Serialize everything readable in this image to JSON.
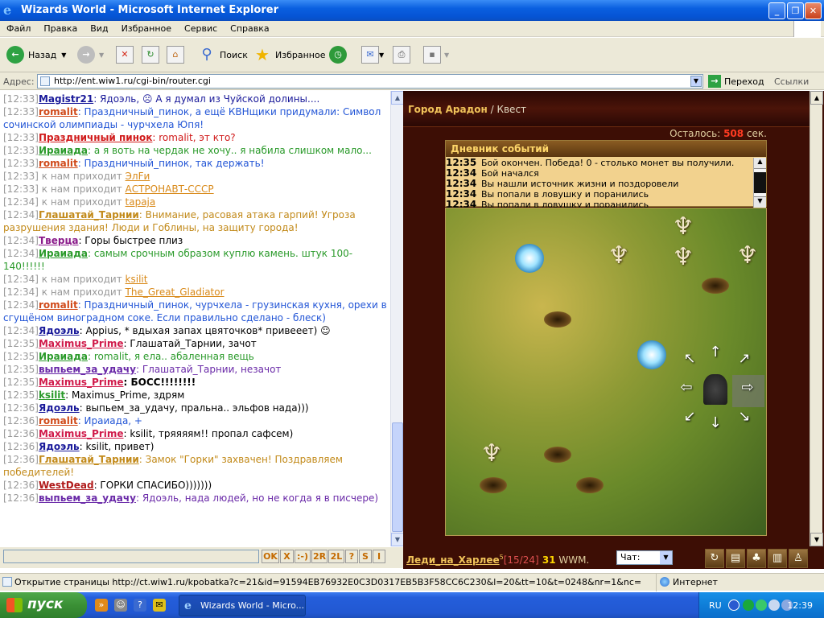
{
  "window": {
    "title": "Wizards World - Microsoft Internet Explorer"
  },
  "menu": [
    "Файл",
    "Правка",
    "Вид",
    "Избранное",
    "Сервис",
    "Справка"
  ],
  "toolbar": {
    "back": "Назад",
    "search": "Поиск",
    "favorites": "Избранное"
  },
  "address": {
    "label": "Адрес:",
    "url": "http://ent.wiw1.ru/cgi-bin/router.cgi",
    "go": "Переход",
    "links": "Ссылки"
  },
  "chat": [
    {
      "time": "[12:33]",
      "user": "Magistr21",
      "ucolor": "#1a1a9a",
      "text": ": Ядоэль, ☹ А я думал из Чуйской долины....",
      "tcolor": "#1a1a9a"
    },
    {
      "time": "[12:33]",
      "user": "romalit",
      "ucolor": "#d04a1a",
      "text": ": Праздничный_пинок, а ещё КВНщики придумали: Символ сочинской олимпиады - чурчхела Юпя!",
      "tcolor": "#2255d6"
    },
    {
      "time": "[12:33]",
      "user": "Праздничный пинок",
      "ucolor": "#d01a1a",
      "text": ": romalit, эт кто?",
      "tcolor": "#d01a1a"
    },
    {
      "time": "[12:33]",
      "user": "Ираиада",
      "ucolor": "#2a9a2a",
      "text": ": а я воть на чердак не хочу.. я набила слишком мало...",
      "tcolor": "#2a9a2a"
    },
    {
      "time": "[12:33]",
      "user": "romalit",
      "ucolor": "#d04a1a",
      "text": ": Праздничный_пинок, так держать!",
      "tcolor": "#2255d6"
    },
    {
      "time": "[12:33]",
      "sys": "к нам приходит",
      "name": "ЭлFи"
    },
    {
      "time": "[12:33]",
      "sys": "к нам приходит",
      "name": "АСТРОНАВТ-СССР"
    },
    {
      "time": "[12:34]",
      "sys": "к нам приходит",
      "name": "tapaja"
    },
    {
      "time": "[12:34]",
      "user": "Глашатай_Тарнии",
      "ucolor": "#c28a1a",
      "text": ": Внимание, расовая атака гарпий! Угроза разрушения здания! Люди и Гоблины, на защиту города!",
      "tcolor": "#c28a1a"
    },
    {
      "time": "[12:34]",
      "user": "Тверца",
      "ucolor": "#8a1a8a",
      "text": ": Горы быстрее плиз",
      "tcolor": "#000"
    },
    {
      "time": "[12:34]",
      "user": "Ираиада",
      "ucolor": "#2a9a2a",
      "text": ": самым срочным образом куплю камень. штук 100-140!!!!!!",
      "tcolor": "#2a9a2a"
    },
    {
      "time": "[12:34]",
      "sys": "к нам приходит",
      "name": "ksilit"
    },
    {
      "time": "[12:34]",
      "sys": "к нам приходит",
      "name": "The_Great_Gladiator"
    },
    {
      "time": "[12:34]",
      "user": "romalit",
      "ucolor": "#d04a1a",
      "text": ": Праздничный_пинок, чурчхела - грузинская кухня, орехи в сгущёном виноградном соке. Если правильно сделано - блеск)",
      "tcolor": "#2255d6"
    },
    {
      "time": "[12:34]",
      "user": "Ядоэль",
      "ucolor": "#1a1a9a",
      "text": ": Appius, * вдыхая запах цвяточков* привееет) ☺",
      "tcolor": "#000"
    },
    {
      "time": "[12:35]",
      "user": "Maximus_Prime",
      "ucolor": "#d01a4a",
      "text": ": Глашатай_Тарнии, зачот",
      "tcolor": "#000"
    },
    {
      "time": "[12:35]",
      "user": "Ираиада",
      "ucolor": "#2a9a2a",
      "text": ": romalit, я ела.. абаленная вещь",
      "tcolor": "#2a9a2a"
    },
    {
      "time": "[12:35]",
      "user": "выпьем_за_удачу",
      "ucolor": "#6a2aa8",
      "text": ": Глашатай_Тарнии, незачот",
      "tcolor": "#6a2aa8"
    },
    {
      "time": "[12:35]",
      "user": "Maximus_Prime",
      "ucolor": "#d01a4a",
      "text": ": БОСС!!!!!!!!",
      "tcolor": "#000",
      "bold": true
    },
    {
      "time": "[12:35]",
      "user": "ksilit",
      "ucolor": "#2a9a2a",
      "text": ": Maximus_Prime, здрям",
      "tcolor": "#000"
    },
    {
      "time": "[12:36]",
      "user": "Ядоэль",
      "ucolor": "#1a1a9a",
      "text": ": выпьем_за_удачу, пральна.. эльфов нада)))",
      "tcolor": "#000"
    },
    {
      "time": "[12:36]",
      "user": "romalit",
      "ucolor": "#d04a1a",
      "text": ": Ираиада, +",
      "tcolor": "#2255d6"
    },
    {
      "time": "[12:36]",
      "user": "Maximus_Prime",
      "ucolor": "#d01a4a",
      "text": ": ksilit, тряяяям!! пропал сафсем)",
      "tcolor": "#000"
    },
    {
      "time": "[12:36]",
      "user": "Ядоэль",
      "ucolor": "#1a1a9a",
      "text": ": ksilit, привет)",
      "tcolor": "#000"
    },
    {
      "time": "[12:36]",
      "user": "Глашатай_Тарнии",
      "ucolor": "#c28a1a",
      "text": ": Замок \"Горки\" захвачен! Поздравляем победителей!",
      "tcolor": "#c28a1a"
    },
    {
      "time": "[12:36]",
      "user": "WestDead",
      "ucolor": "#b01a1a",
      "text": ": ГОРКИ СПАСИБО)))))))",
      "tcolor": "#000"
    },
    {
      "time": "[12:36]",
      "user": "выпьем_за_удачу",
      "ucolor": "#6a2aa8",
      "text": ": Ядоэль, нада людей, но не когда я в писчере)",
      "tcolor": "#6a2aa8"
    }
  ],
  "chat_buttons": [
    "OK",
    "X",
    ":-)",
    "2R",
    "2L",
    "?",
    "S",
    "I"
  ],
  "game": {
    "city": "Город Арадон",
    "sep": " / ",
    "mode": "Квест",
    "timer_label": "Осталось: ",
    "timer_value": "508",
    "timer_unit": " сек.",
    "diary_title": "Дневник событий",
    "events": [
      {
        "time": "12:35",
        "text": "Бой окончен. Победа! 0 - столько монет вы получили."
      },
      {
        "time": "12:34",
        "text": "Бой начался"
      },
      {
        "time": "12:34",
        "text": "Вы нашли источник жизни и поздоровели"
      },
      {
        "time": "12:34",
        "text": "Вы попали в ловушку и поранились"
      },
      {
        "time": "12:34",
        "text": "Вы попали в ловушку и поранились"
      }
    ],
    "player_name": "Леди_на_Харлее",
    "player_level": "5",
    "player_hp": "[15/24]",
    "player_money": "31",
    "currency": " WWM.",
    "chat_select": "Чат:"
  },
  "status": {
    "text": "Открытие страницы http://ct.wiw1.ru/kpobatka?c=21&id=91594EB76932E0C3D0317EB5B3F58CC6C230&l=20&tt=10&t=0248&nr=1&nc=",
    "zone": "Интернет"
  },
  "taskbar": {
    "start": "пуск",
    "task": "Wizards World - Micro...",
    "lang": "RU",
    "clock": "12:39"
  }
}
